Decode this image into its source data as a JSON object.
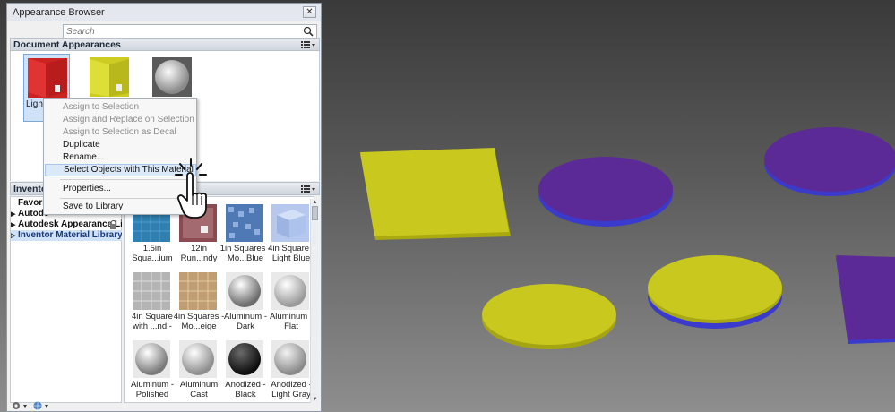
{
  "window": {
    "title": "Appearance Browser",
    "close_label": "✕"
  },
  "search": {
    "placeholder": "Search"
  },
  "document_appearances": {
    "header": "Document Appearances",
    "items": [
      {
        "name": "Light",
        "color": "#d42b2b",
        "selected": true
      },
      {
        "name": "",
        "color": "#d6d62a",
        "selected": false
      },
      {
        "name": "",
        "color": "#c4c4c4",
        "selected": false
      }
    ]
  },
  "context_menu": {
    "items": [
      {
        "label": "Assign to Selection",
        "enabled": false
      },
      {
        "label": "Assign and Replace on Selection",
        "enabled": false
      },
      {
        "label": "Assign to Selection as Decal",
        "enabled": false
      },
      {
        "label": "Duplicate",
        "enabled": true
      },
      {
        "label": "Rename...",
        "enabled": true
      },
      {
        "label": "Select Objects with This Material",
        "enabled": true,
        "hover": true
      },
      {
        "label": "Properties...",
        "enabled": true
      },
      {
        "label": "Save to Library",
        "enabled": true
      }
    ]
  },
  "library": {
    "header": "Inventor",
    "tree": [
      {
        "label": "Favorite",
        "arrow": "",
        "selected": false
      },
      {
        "label": "Autode",
        "arrow": "▶",
        "selected": false
      },
      {
        "label": "Autodesk Appearance Li...",
        "arrow": "▶",
        "selected": false,
        "locked": true
      },
      {
        "label": "Inventor Material Library",
        "arrow": "▷",
        "selected": true
      }
    ],
    "materials": [
      {
        "label": "1.5in Squa...ium",
        "color": "#3a8fc0"
      },
      {
        "label": "12in Run...ndy",
        "color": "#b4878a"
      },
      {
        "label": "1in Squares - Mo...Blue",
        "color": "#5a86c6"
      },
      {
        "label": "4in Square - Light Blue",
        "color": "#b6c8ee"
      },
      {
        "label": "4in Square with ...nd -",
        "color": "#c9c9c9"
      },
      {
        "label": "4in Squares - Mo...eige",
        "color": "#c7ab86"
      },
      {
        "label": "Aluminum - Dark",
        "color": "#9c9c9c"
      },
      {
        "label": "Aluminum - Flat",
        "color": "#d8d8d8"
      },
      {
        "label": "Aluminum - Polished",
        "color": "#b9b9b9"
      },
      {
        "label": "Aluminum Cast",
        "color": "#c4c4c4"
      },
      {
        "label": "Anodized - Black",
        "color": "#2a2a2a"
      },
      {
        "label": "Anodized - Light Gray",
        "color": "#bdbdbd"
      }
    ]
  },
  "scene": {
    "yellow": "#c8c81e",
    "purple": "#5c2a96",
    "blue_edge": "#3a3acc"
  }
}
